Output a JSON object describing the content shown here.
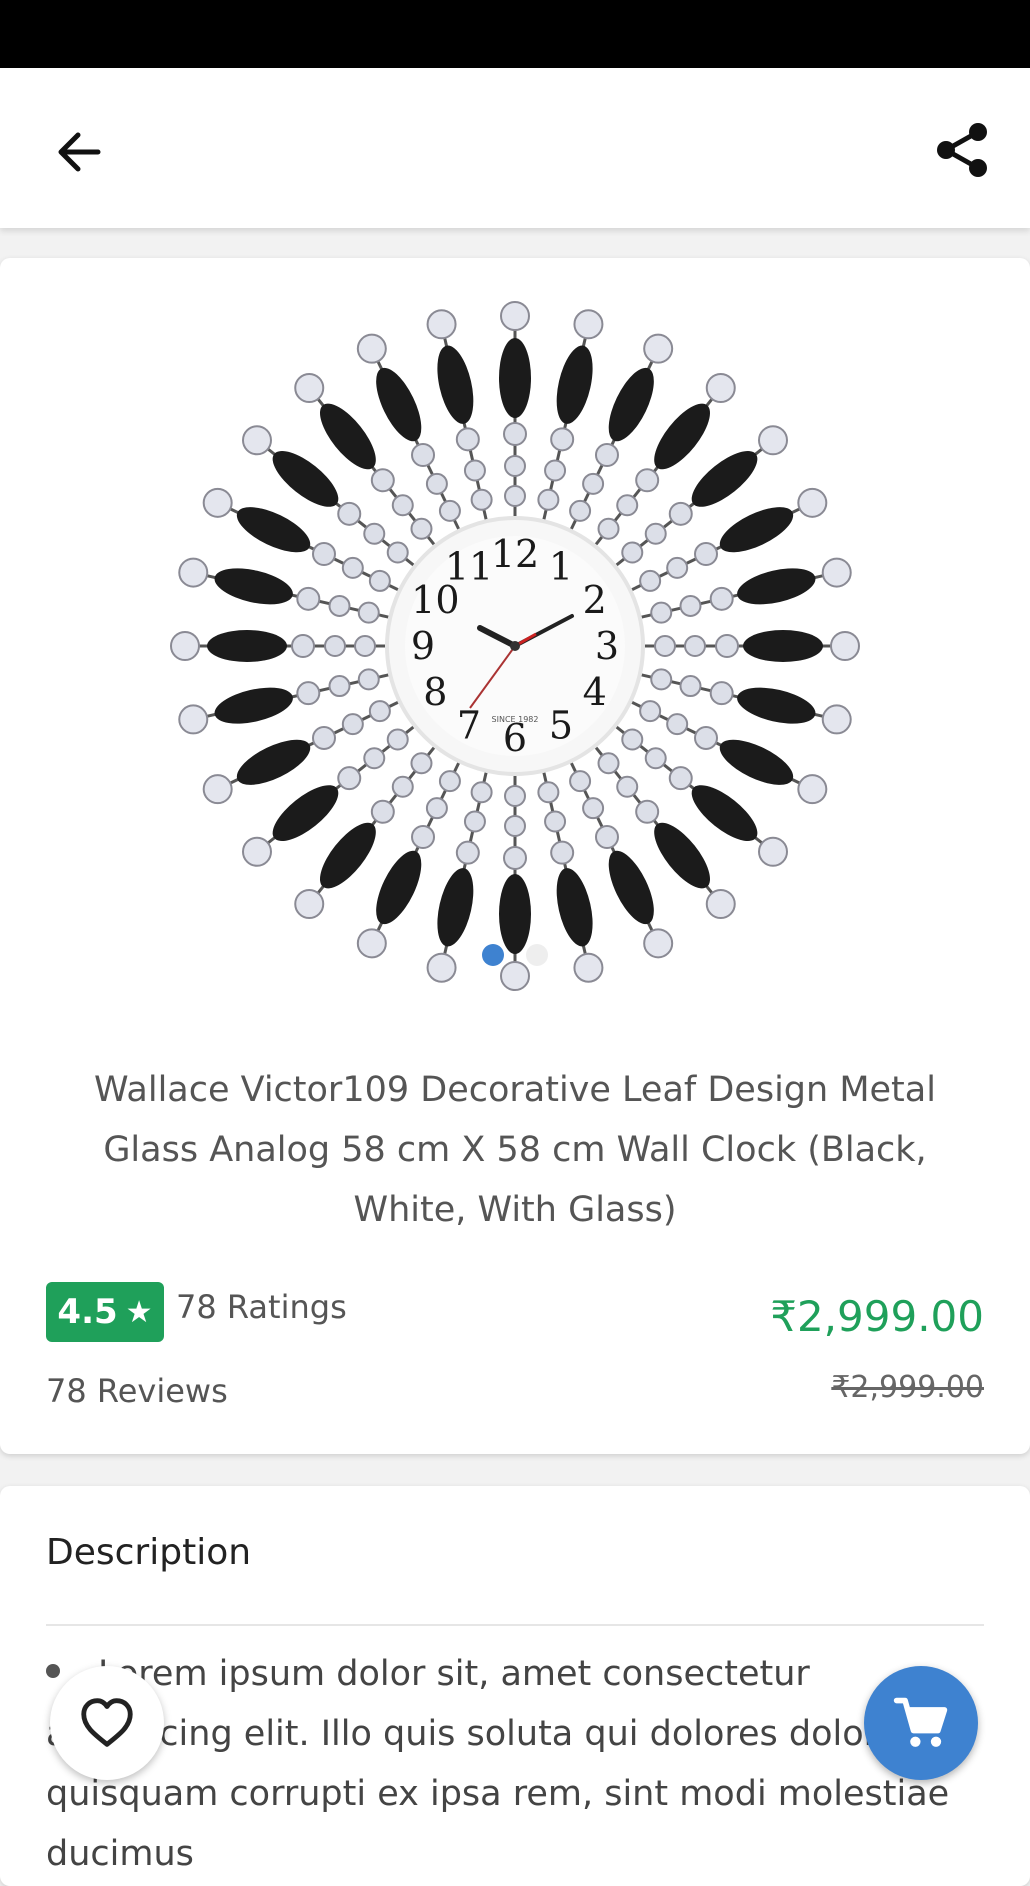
{
  "icons": {
    "back": "arrow-left-icon",
    "share": "share-icon",
    "wishlist": "heart-outline-icon",
    "cart": "shopping-cart-icon",
    "rating_star": "star-icon"
  },
  "colors": {
    "accent_blue": "#3e82d0",
    "rating_green": "#1fa05a",
    "price_green": "#1fa05a"
  },
  "carousel": {
    "image_alt": "Wall clock product image",
    "clock_numbers": [
      "12",
      "1",
      "2",
      "3",
      "4",
      "5",
      "6",
      "7",
      "8",
      "9",
      "10",
      "11"
    ],
    "clock_brand_text": "SINCE 1982",
    "total_slides": 2,
    "active_slide": 1
  },
  "product": {
    "title": "Wallace Victor109 Decorative Leaf Design Metal Glass Analog 58 cm X 58 cm Wall Clock (Black, White, With Glass)",
    "rating": "4.5",
    "rating_star": "★",
    "ratings_text": "78 Ratings",
    "reviews_text": "78 Reviews",
    "price": "₹2,999.00",
    "mrp": "₹2,999.00"
  },
  "description": {
    "heading": "Description",
    "text": "Lorem ipsum dolor sit, amet consectetur adipisicing elit. Illo quis soluta qui dolores dolor quisquam corrupti ex ipsa rem, sint modi molestiae ducimus"
  }
}
